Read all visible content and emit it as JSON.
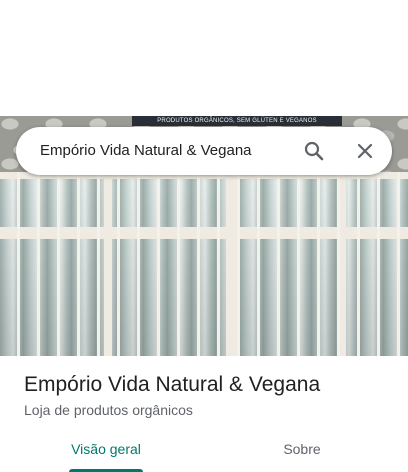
{
  "search": {
    "query": "Empório Vida Natural & Vegana"
  },
  "photo": {
    "sign_text": "PRODUTOS ORGÂNICOS, SEM GLÚTEN E VEGANOS"
  },
  "place": {
    "name": "Empório Vida Natural & Vegana",
    "category": "Loja de produtos orgânicos"
  },
  "tabs": [
    {
      "label": "Visão geral",
      "selected": true
    },
    {
      "label": "Sobre",
      "selected": false
    }
  ],
  "icons": {
    "search": "search-icon",
    "close": "close-icon"
  },
  "colors": {
    "accent": "#00796b",
    "title_text": "#202124",
    "secondary_text": "#5f6368"
  }
}
